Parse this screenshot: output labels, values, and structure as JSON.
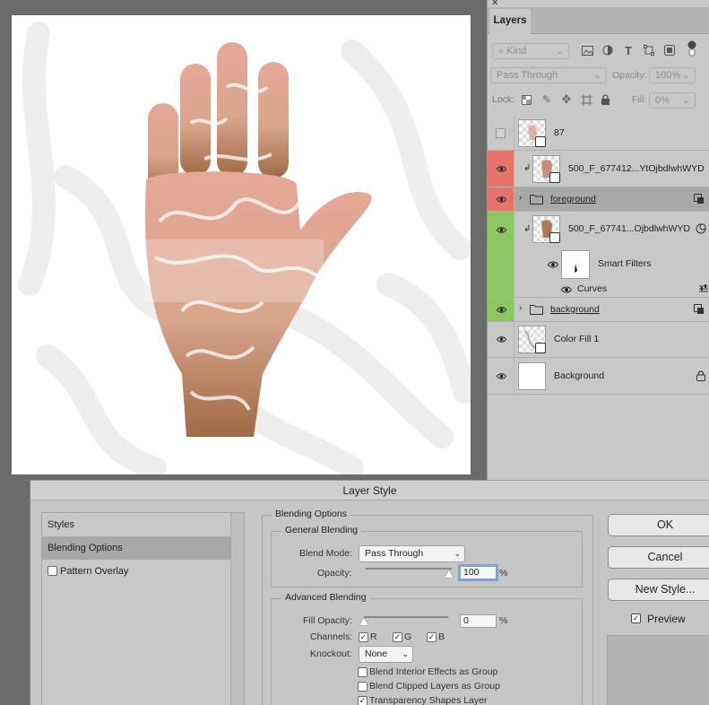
{
  "layers_panel": {
    "tab_label": "Layers",
    "filter_kind": "Kind",
    "blend_mode": "Pass Through",
    "opacity_label": "Opacity:",
    "opacity_value": "100%",
    "lock_label": "Lock:",
    "fill_label": "Fill:",
    "fill_value": "0%",
    "layers": [
      {
        "name": "87",
        "visible": false
      },
      {
        "name": "500_F_677412...YtOjbdlwhWYD",
        "visible": true,
        "color": "#e7736b"
      },
      {
        "name": "foreground",
        "visible": true,
        "color": "#e7736b"
      },
      {
        "name": "500_F_67741...OjbdlwhWYD",
        "visible": true,
        "color": "#8cc763"
      },
      {
        "name": "Smart Filters"
      },
      {
        "name": "Curves"
      },
      {
        "name": "background",
        "visible": true,
        "color": "#8cc763"
      },
      {
        "name": "Color Fill 1",
        "visible": true
      },
      {
        "name": "Background",
        "visible": true
      }
    ]
  },
  "dialog": {
    "title": "Layer Style",
    "styles_list": [
      "Styles",
      "Blending Options",
      "Pattern Overlay"
    ],
    "section_title": "Blending Options",
    "general_title": "General Blending",
    "blend_mode_label": "Blend Mode:",
    "blend_mode_value": "Pass Through",
    "opacity_label": "Opacity:",
    "opacity_value": "100",
    "percent": "%",
    "advanced_title": "Advanced Blending",
    "fill_opacity_label": "Fill Opacity:",
    "fill_opacity_value": "0",
    "channels_label": "Channels:",
    "channel_r": "R",
    "channel_g": "G",
    "channel_b": "B",
    "knockout_label": "Knockout:",
    "knockout_value": "None",
    "options": [
      {
        "label": "Blend Interior Effects as Group",
        "checked": false
      },
      {
        "label": "Blend Clipped Layers as Group",
        "checked": false
      },
      {
        "label": "Transparency Shapes Layer",
        "checked": true
      }
    ],
    "buttons": {
      "ok": "OK",
      "cancel": "Cancel",
      "new_style": "New Style..."
    },
    "preview_label": "Preview",
    "preview_checked": true
  },
  "icons": [
    "close-icon",
    "search-icon",
    "image-filter-icon",
    "adjustment-filter-icon",
    "type-filter-icon",
    "shape-filter-icon",
    "smart-object-filter-icon",
    "filter-toggle-icon",
    "lock-transparent-icon",
    "lock-paint-icon",
    "lock-move-icon",
    "lock-artboard-icon",
    "lock-all-icon",
    "eye-icon",
    "folder-icon",
    "chevron-right-icon",
    "clip-arrow-icon",
    "smart-object-badge-icon",
    "lock-icon"
  ]
}
